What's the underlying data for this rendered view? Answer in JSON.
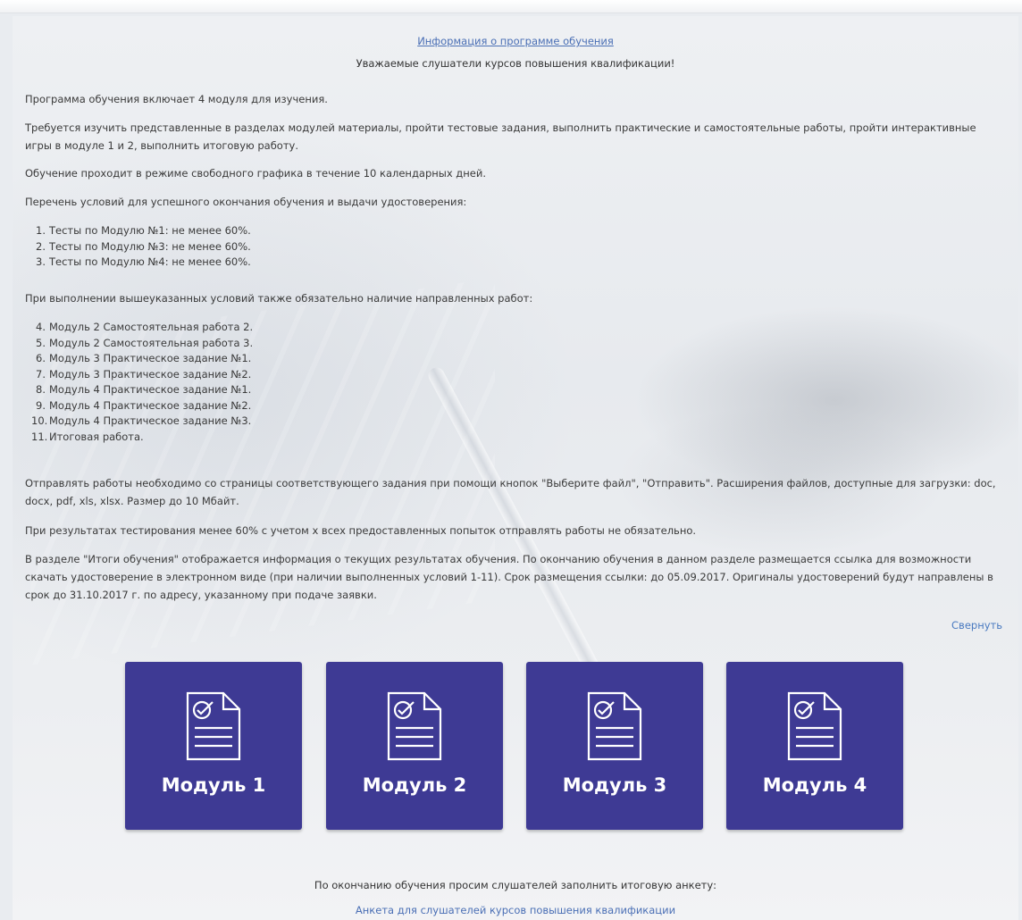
{
  "header": {
    "link": "Информация о программе обучения",
    "greeting": "Уважаемые слушатели курсов повышения квалификации!"
  },
  "intro": {
    "p1": "Программа обучения включает 4 модуля для изучения.",
    "p2": "Требуется изучить представленные в разделах модулей материалы, пройти тестовые задания, выполнить практические и самостоятельные работы, пройти интерактивные игры в модуле 1 и 2, выполнить итоговую работу.",
    "p3": "Обучение проходит в режиме свободного графика в течение 10 календарных дней.",
    "p4": "Перечень условий для успешного окончания обучения и выдачи удостоверения:"
  },
  "conditions": [
    {
      "num": "1.",
      "text": "Тесты по Модулю №1: не менее 60%."
    },
    {
      "num": "2.",
      "text": "Тесты по Модулю №3: не менее 60%."
    },
    {
      "num": "3.",
      "text": "Тесты по Модулю №4: не менее 60%."
    }
  ],
  "works_intro": "При выполнении вышеуказанных условий также обязательно наличие направленных работ:",
  "works": [
    {
      "num": "4.",
      "text": "Модуль 2 Самостоятельная работа 2."
    },
    {
      "num": "5.",
      "text": "Модуль 2 Самостоятельная работа 3."
    },
    {
      "num": "6.",
      "text": "Модуль 3 Практическое задание №1."
    },
    {
      "num": "7.",
      "text": "Модуль 3 Практическое задание №2."
    },
    {
      "num": "8.",
      "text": "Модуль 4 Практическое задание №1."
    },
    {
      "num": "9.",
      "text": "Модуль 4 Практическое задание №2."
    },
    {
      "num": "10.",
      "text": "Модуль 4 Практическое задание №3."
    },
    {
      "num": "11.",
      "text": "Итоговая работа."
    }
  ],
  "notes": {
    "p1": "Отправлять работы необходимо со страницы соответствующего задания при помощи кнопок \"Выберите файл\", \"Отправить\". Расширения файлов, доступные для загрузки: doc, docx, pdf, xls, xlsx. Размер до 10 Мбайт.",
    "p2": "При результатах тестирования менее 60% с учетом х всех предоставленных попыток отправлять работы не обязательно.",
    "p3": "В разделе \"Итоги обучения\" отображается информация о текущих результатах обучения. По окончанию обучения в данном разделе размещается ссылка для возможности скачать удостоверение в электронном виде (при наличии выполненных условий 1-11). Срок размещения ссылки: до 05.09.2017. Оригиналы удостоверений будут направлены в срок до 31.10.2017 г. по адресу, указанному при подаче заявки."
  },
  "collapse_label": "Свернуть",
  "modules": [
    {
      "label": "Модуль 1",
      "icon": "document-check-icon"
    },
    {
      "label": "Модуль 2",
      "icon": "document-check-icon"
    },
    {
      "label": "Модуль 3",
      "icon": "document-check-icon"
    },
    {
      "label": "Модуль 4",
      "icon": "document-check-icon"
    }
  ],
  "colors": {
    "module_tile": "#3e3a94",
    "link": "#4a6fb5"
  },
  "footer": {
    "text": "По окончанию обучения просим слушателей заполнить итоговую анкету:",
    "link": "Анкета для слушателей курсов повышения квалификации"
  }
}
